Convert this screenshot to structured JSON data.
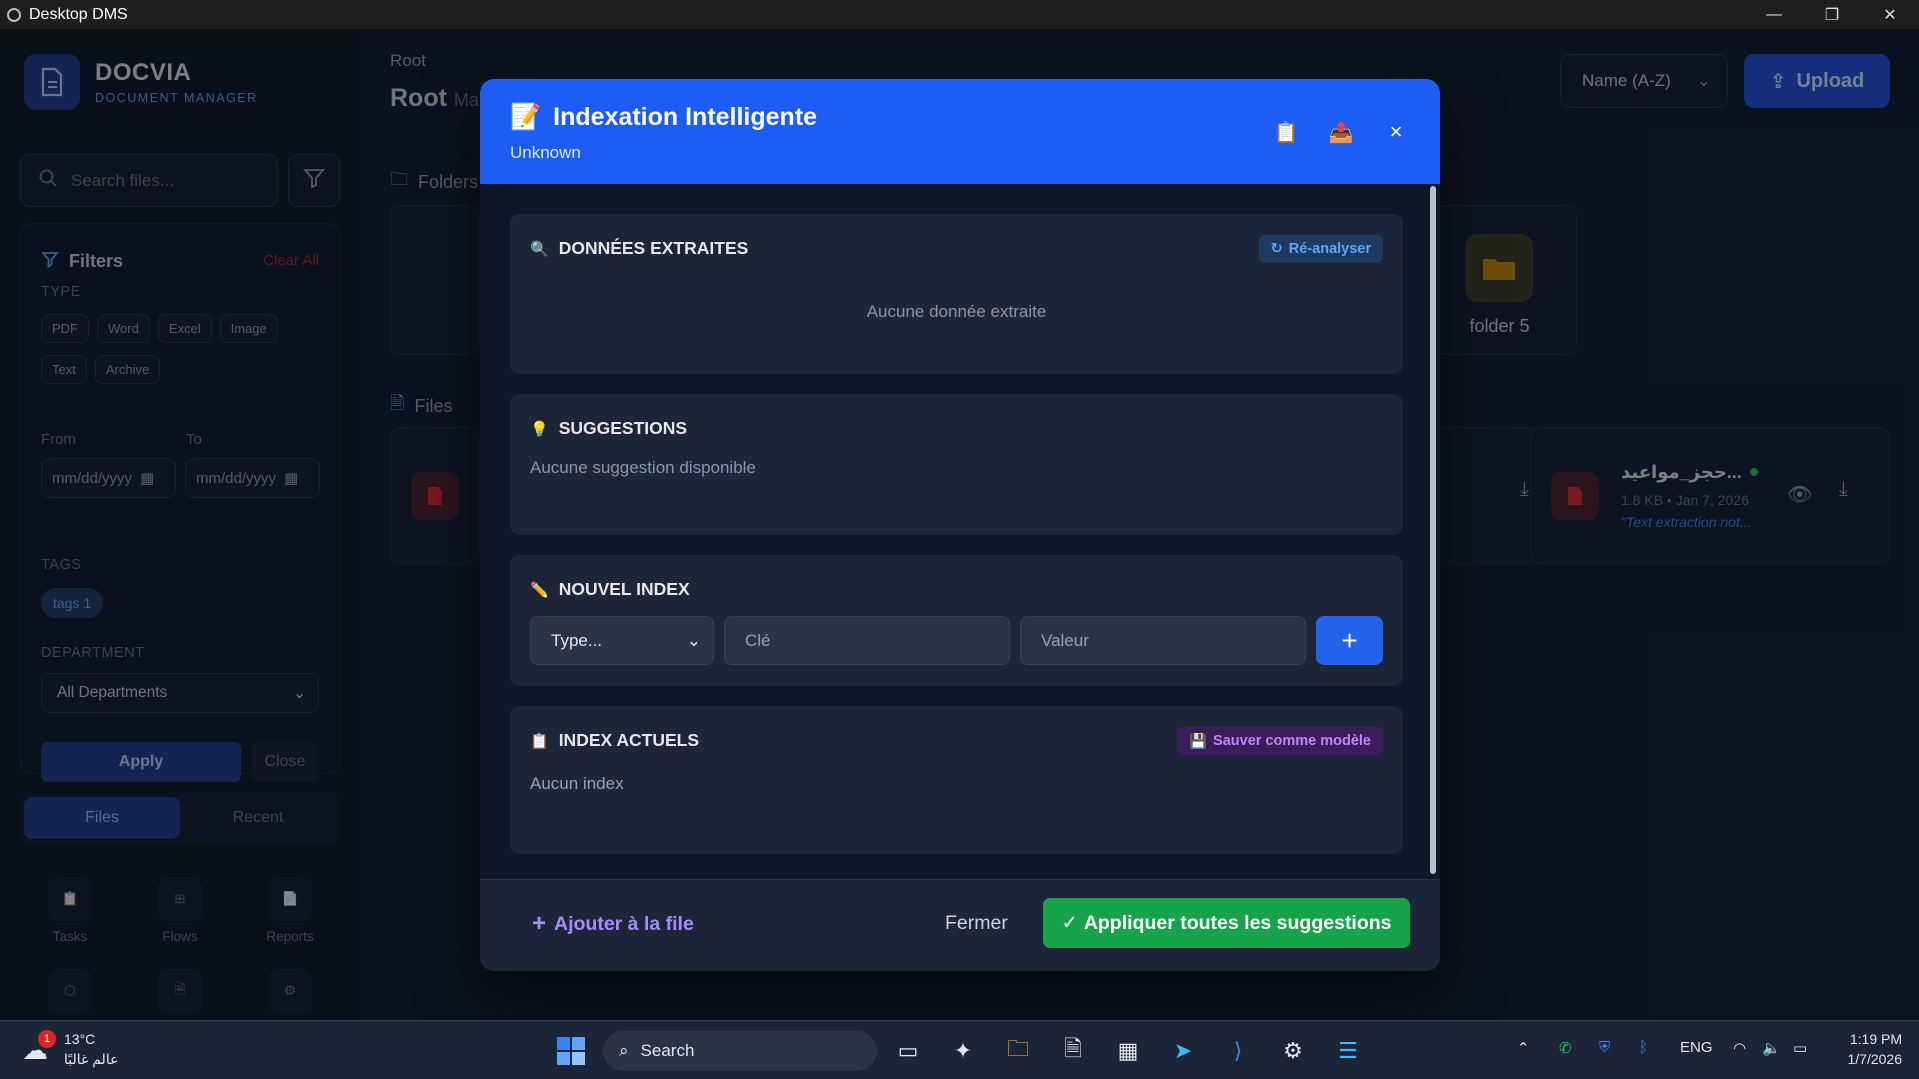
{
  "window": {
    "title": "Desktop DMS",
    "minimize": "—",
    "restore": "❐",
    "close": "✕"
  },
  "sidebar": {
    "brand": "DOCVIA",
    "brand_sub": "DOCUMENT MANAGER",
    "search_placeholder": "Search files...",
    "filters": {
      "title": "Filters",
      "clear_all": "Clear All",
      "type_label": "TYPE",
      "types": [
        "PDF",
        "Word",
        "Excel",
        "Image",
        "Text",
        "Archive"
      ],
      "from_label": "From",
      "to_label": "To",
      "date_placeholder": "mm/dd/yyyy",
      "tags_label": "TAGS",
      "tag": "tags 1",
      "department_label": "DEPARTMENT",
      "department_value": "All Departments",
      "apply": "Apply",
      "close": "Close"
    },
    "tabs": [
      "Files",
      "Recent"
    ],
    "tools": [
      "Tasks",
      "Flows",
      "Reports"
    ]
  },
  "main": {
    "breadcrumb": "Root",
    "title": "Root",
    "title_suffix": "Ma",
    "sort": "Name (A-Z)",
    "upload": "Upload",
    "folders_label": "Folders",
    "folder_name": "folder 5",
    "files_label": "Files",
    "file": {
      "name": "حجز_مواعيد...",
      "meta": "1.8 KB • Jan 7, 2026",
      "note": "\"Text extraction not..."
    }
  },
  "modal": {
    "title": "Indexation Intelligente",
    "subtitle": "Unknown",
    "close": "×",
    "extracted": {
      "title": "DONNÉES EXTRAITES",
      "reanalyze": "Ré-analyser",
      "empty": "Aucune donnée extraite"
    },
    "suggestions": {
      "title": "SUGGESTIONS",
      "empty": "Aucune suggestion disponible"
    },
    "new_index": {
      "title": "NOUVEL INDEX",
      "type_placeholder": "Type...",
      "key_placeholder": "Clé",
      "value_placeholder": "Valeur",
      "add": "+"
    },
    "current": {
      "title": "INDEX ACTUELS",
      "save_template": "Sauver comme modèle",
      "empty": "Aucun index"
    },
    "footer": {
      "add_queue": "Ajouter à la file",
      "close": "Fermer",
      "apply_all": "Appliquer toutes les suggestions"
    }
  },
  "taskbar": {
    "weather_temp": "13°C",
    "weather_desc": "عالم غالبًا",
    "notif_count": "1",
    "search": "Search",
    "lang": "ENG",
    "time": "1:19 PM",
    "date": "1/7/2026"
  }
}
